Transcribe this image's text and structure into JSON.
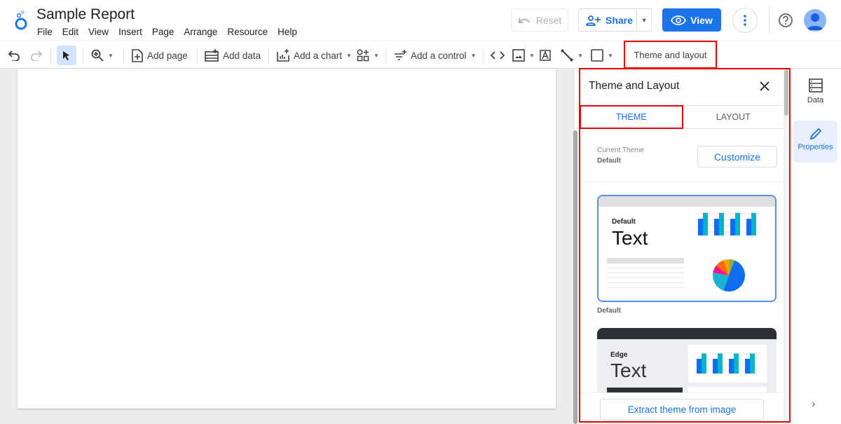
{
  "header": {
    "title": "Sample Report",
    "menu": [
      "File",
      "Edit",
      "View",
      "Insert",
      "Page",
      "Arrange",
      "Resource",
      "Help"
    ],
    "reset_label": "Reset",
    "share_label": "Share",
    "view_label": "View"
  },
  "toolbar": {
    "add_page": "Add page",
    "add_data": "Add data",
    "add_chart": "Add a chart",
    "add_control": "Add a control",
    "theme_layout": "Theme and layout"
  },
  "panel": {
    "title": "Theme and Layout",
    "tabs": [
      {
        "label": "THEME",
        "active": true
      },
      {
        "label": "LAYOUT",
        "active": false
      }
    ],
    "current_theme_label": "Current Theme",
    "current_theme_value": "Default",
    "customize_label": "Customize",
    "themes": [
      {
        "name": "Default",
        "preview_title": "Default",
        "preview_text": "Text",
        "selected": true
      },
      {
        "name": "Edge",
        "preview_title": "Edge",
        "preview_text": "Text",
        "selected": false
      }
    ],
    "extract_label": "Extract theme from image"
  },
  "rail": {
    "data_label": "Data",
    "properties_label": "Properties"
  },
  "colors": {
    "accent": "#1a73e8",
    "highlight": "#e00000",
    "bar_primary": "#0f6ef0",
    "bar_secondary": "#00b4cc"
  }
}
